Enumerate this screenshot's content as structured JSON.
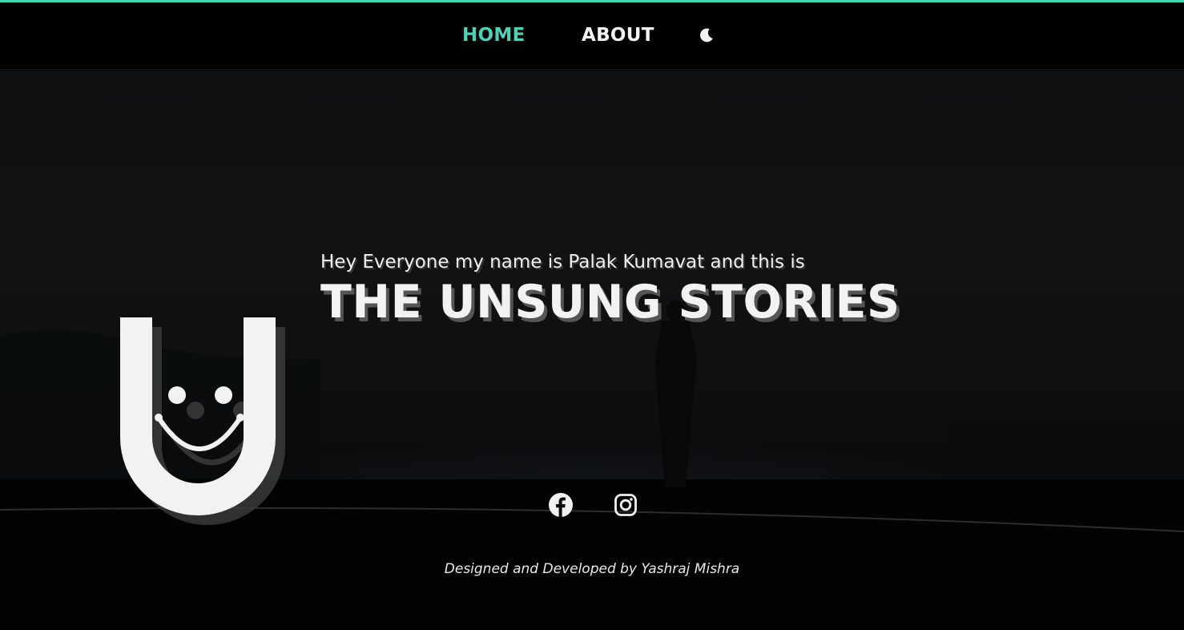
{
  "nav": {
    "home_label": "HOME",
    "about_label": "ABOUT",
    "theme_toggle_icon": "moon-icon",
    "active_color": "#4fd1b7",
    "accent_color": "#3fd7b6"
  },
  "hero": {
    "intro": "Hey Everyone my name is Palak Kumavat and this is",
    "title": "THE UNSUNG STORIES",
    "logo_icon": "smiling-u-logo"
  },
  "social": {
    "facebook_icon": "facebook-icon",
    "instagram_icon": "instagram-icon"
  },
  "footer": {
    "credit": "Designed and Developed by Yashraj Mishra"
  }
}
